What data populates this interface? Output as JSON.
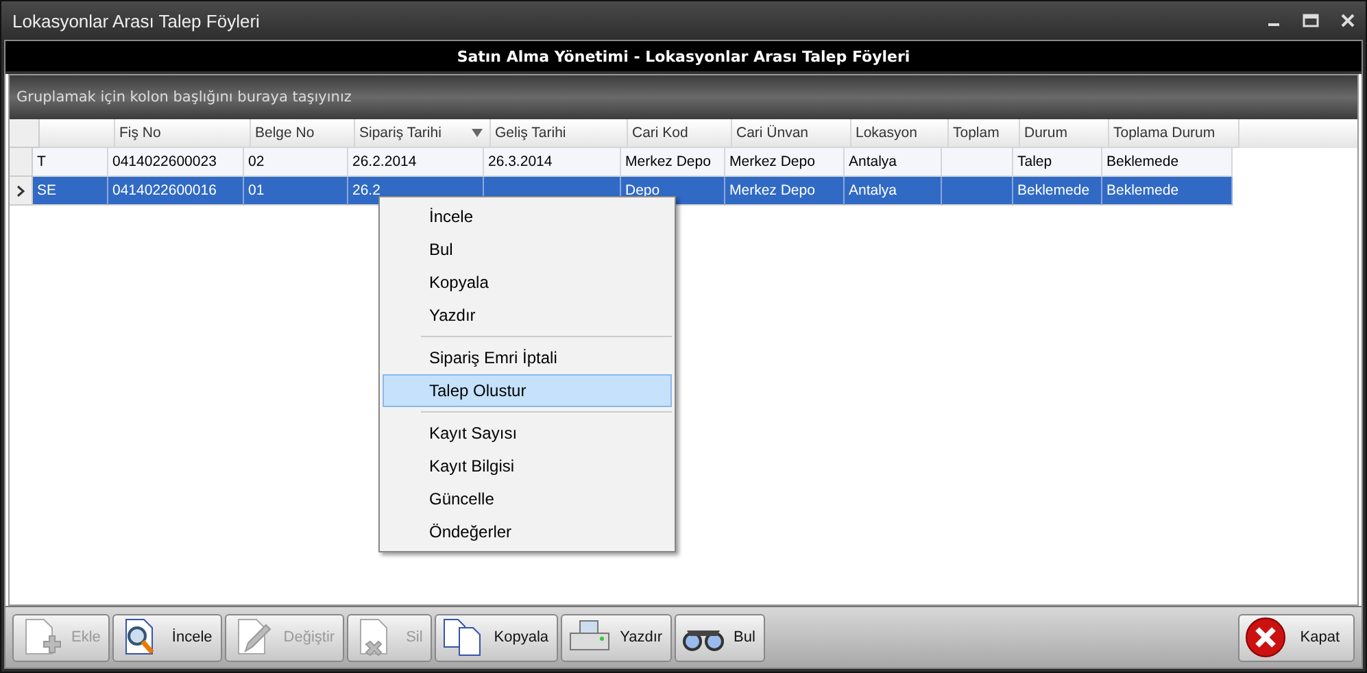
{
  "window": {
    "title": "Lokasyonlar Arası Talep Föyleri"
  },
  "header": {
    "title": "Satın Alma Yönetimi - Lokasyonlar Arası Talep Föyleri"
  },
  "group_panel": {
    "hint": "Gruplamak için kolon başlığını buraya taşıyınız"
  },
  "table": {
    "columns": [
      {
        "sorted": false
      },
      {
        "label": "Fiş No",
        "sorted": false
      },
      {
        "label": "Belge No",
        "sorted": false
      },
      {
        "label": "Sipariş Tarihi",
        "sorted": true
      },
      {
        "label": "Geliş Tarihi",
        "sorted": false
      },
      {
        "label": "Cari Kod",
        "sorted": false
      },
      {
        "label": "Cari Ünvan",
        "sorted": false
      },
      {
        "label": "Lokasyon",
        "sorted": false
      },
      {
        "label": "Toplam",
        "sorted": false
      },
      {
        "label": "Durum",
        "sorted": false
      },
      {
        "label": "Toplama Durum",
        "sorted": false
      }
    ],
    "rows": [
      {
        "selected": false,
        "cells": [
          "T",
          "0414022600023",
          "02",
          "26.2.2014",
          "26.3.2014",
          "Merkez Depo",
          "Merkez Depo",
          "Antalya",
          null,
          "Talep",
          "Beklemede"
        ]
      },
      {
        "selected": true,
        "cells": [
          "SE",
          "0414022600016",
          "01",
          "26.2",
          null,
          "Depo",
          "Merkez Depo",
          "Antalya",
          null,
          "Beklemede",
          "Beklemede"
        ]
      }
    ]
  },
  "context_menu": {
    "items": [
      {
        "kind": "item",
        "label": "İncele",
        "selected": false
      },
      {
        "kind": "item",
        "label": "Bul",
        "selected": false
      },
      {
        "kind": "item",
        "label": "Kopyala",
        "selected": false
      },
      {
        "kind": "item",
        "label": "Yazdır",
        "selected": false
      },
      {
        "kind": "separator"
      },
      {
        "kind": "item",
        "label": "Sipariş Emri İptali",
        "selected": false
      },
      {
        "kind": "item",
        "label": "Talep Olustur",
        "selected": true
      },
      {
        "kind": "separator"
      },
      {
        "kind": "item",
        "label": "Kayıt Sayısı",
        "selected": false
      },
      {
        "kind": "item",
        "label": "Kayıt Bilgisi",
        "selected": false
      },
      {
        "kind": "item",
        "label": "Güncelle",
        "selected": false
      },
      {
        "kind": "item",
        "label": "Öndeğerler",
        "selected": false
      }
    ]
  },
  "toolbar": {
    "buttons": [
      {
        "kind": "add",
        "label": "Ekle",
        "disabled": true
      },
      {
        "kind": "view",
        "label": "İncele",
        "disabled": false
      },
      {
        "kind": "edit",
        "label": "Değiştir",
        "disabled": true
      },
      {
        "kind": "delete",
        "label": "Sil",
        "disabled": true
      },
      {
        "kind": "copy",
        "label": "Kopyala",
        "disabled": false
      },
      {
        "kind": "print",
        "label": "Yazdır",
        "disabled": false
      },
      {
        "kind": "find",
        "label": "Bul",
        "disabled": false
      }
    ],
    "close_button": {
      "label": "Kapat",
      "disabled": false
    }
  }
}
